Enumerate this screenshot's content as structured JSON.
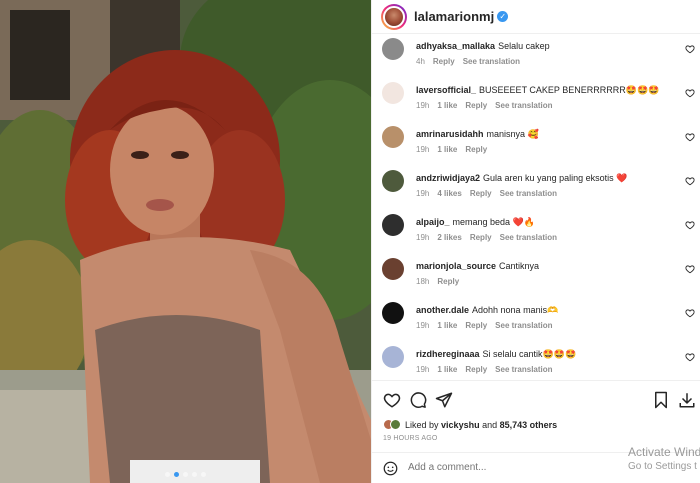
{
  "post": {
    "username": "lalamarionmj",
    "verified_icon": "verified-badge-icon",
    "carousel": {
      "slides": 5,
      "active_index": 1
    }
  },
  "comments": [
    {
      "username": "adhyaksa_mallaka",
      "text": "Selalu cakep",
      "time": "4h",
      "likes": "",
      "reply": "Reply",
      "translation": "See translation",
      "avatar_color": "#8a8a8a"
    },
    {
      "username": "laversofficial_",
      "text": "BUSEEEET CAKEP BENERRRRRR🤩🤩🤩",
      "time": "19h",
      "likes": "1 like",
      "reply": "Reply",
      "translation": "See translation",
      "avatar_color": "#f2e6e0"
    },
    {
      "username": "amrinarusidahh",
      "text": "manisnya 🥰",
      "time": "19h",
      "likes": "1 like",
      "reply": "Reply",
      "translation": "",
      "avatar_color": "#b8906a"
    },
    {
      "username": "andzriwidjaya2",
      "text": "Gula aren ku yang paling eksotis ❤️",
      "time": "19h",
      "likes": "4 likes",
      "reply": "Reply",
      "translation": "See translation",
      "avatar_color": "#4e5a3c"
    },
    {
      "username": "alpaijo_",
      "text": "memang beda ❤️🔥",
      "time": "19h",
      "likes": "2 likes",
      "reply": "Reply",
      "translation": "See translation",
      "avatar_color": "#2e2e2e"
    },
    {
      "username": "marionjola_source",
      "text": "Cantiknya",
      "time": "18h",
      "likes": "",
      "reply": "Reply",
      "translation": "",
      "avatar_color": "#6a4030"
    },
    {
      "username": "another.dale",
      "text": "Adohh nona manis🫶",
      "time": "19h",
      "likes": "1 like",
      "reply": "Reply",
      "translation": "See translation",
      "avatar_color": "#111111"
    },
    {
      "username": "rizdhereginaaa",
      "text": "Si selalu cantik🤩🤩🤩",
      "time": "19h",
      "likes": "1 like",
      "reply": "Reply",
      "translation": "See translation",
      "avatar_color": "#a7b4d6"
    }
  ],
  "likes": {
    "prefix": "Liked by",
    "user": "vickyshu",
    "conjunction": "and",
    "others": "85,743 others"
  },
  "timestamp": "19 HOURS AGO",
  "add_comment": {
    "placeholder": "Add a comment..."
  },
  "watermark": {
    "line1": "Activate Wind",
    "line2": "Go to Settings t"
  },
  "icons": {
    "like": "heart-icon",
    "comment": "comment-icon",
    "share": "send-icon",
    "save": "bookmark-icon",
    "download": "download-icon",
    "emoji": "smile-icon"
  },
  "colors": {
    "verified": "#3897f0",
    "muted": "#8e8e8e",
    "text": "#262626"
  }
}
